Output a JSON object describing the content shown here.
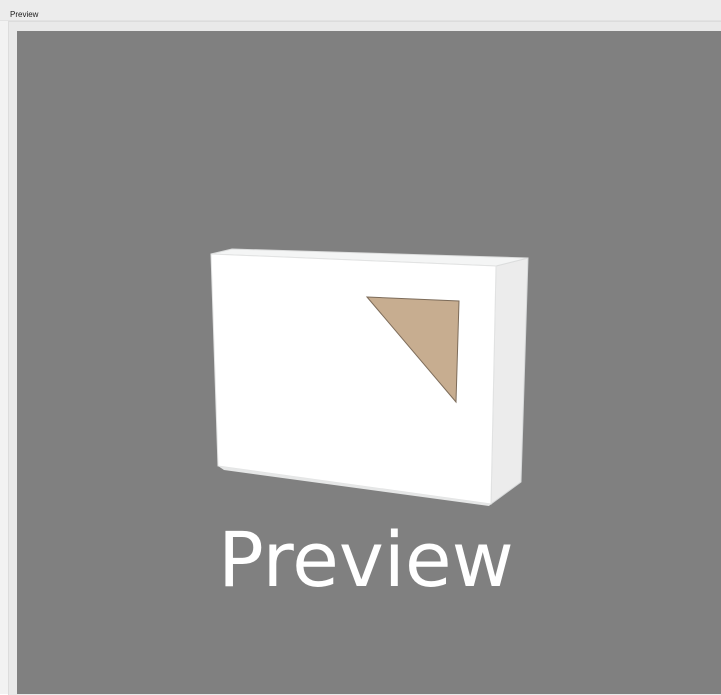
{
  "window": {
    "title": "Preview"
  },
  "preview": {
    "background_color": "#808080",
    "watermark_text": "Preview",
    "box": {
      "body_color": "#ffffff",
      "side_color": "#ececec",
      "window_color": "#c7ad90"
    }
  }
}
